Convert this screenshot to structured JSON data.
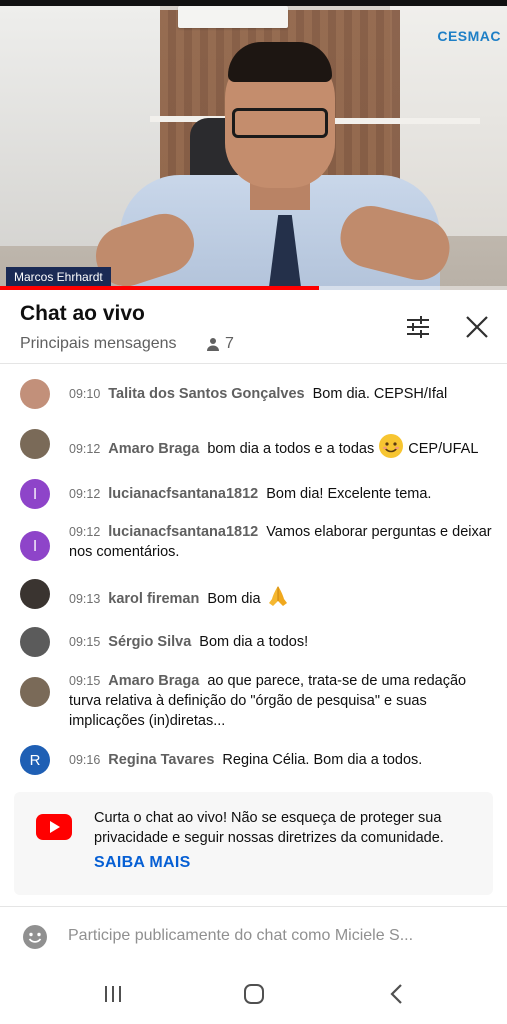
{
  "video": {
    "brand_text": "CESMAC",
    "presenter_name": "Marcos Ehrhardt",
    "progress_fraction": 0.63,
    "colors": {
      "progress": "#ff0000",
      "name_tag_bg": "#1a2a55",
      "brand": "#1e7fc6"
    }
  },
  "chat_header": {
    "title": "Chat ao vivo",
    "mode_label": "Principais mensagens",
    "viewer_count": "7",
    "icons": {
      "viewers": "person-icon",
      "filter": "sliders-icon",
      "close": "close-icon"
    }
  },
  "messages": [
    {
      "time": "09:10",
      "author": "Talita dos Santos Gonçalves",
      "text": "Bom dia. CEPSH/Ifal",
      "avatar_letter": "",
      "avatar_color": "#c2907a"
    },
    {
      "time": "09:12",
      "author": "Amaro Braga",
      "text": "bom dia a todos e a todas",
      "emoji": "😊",
      "text_after": "CEP/UFAL",
      "avatar_letter": "",
      "avatar_color": "#7a6a58"
    },
    {
      "time": "09:12",
      "author": "lucianacfsantana1812",
      "text": "Bom dia! Excelente tema.",
      "avatar_letter": "l",
      "avatar_color": "#8e44c9"
    },
    {
      "time": "09:12",
      "author": "lucianacfsantana1812",
      "text": "Vamos elaborar perguntas e deixar nos comentários.",
      "avatar_letter": "l",
      "avatar_color": "#8e44c9"
    },
    {
      "time": "09:13",
      "author": "karol fireman",
      "text": "Bom dia",
      "emoji": "🙏",
      "avatar_letter": "",
      "avatar_color": "#3a3430"
    },
    {
      "time": "09:15",
      "author": "Sérgio Silva",
      "text": "Bom dia a todos!",
      "avatar_letter": "",
      "avatar_color": "#5b5b5b"
    },
    {
      "time": "09:15",
      "author": "Amaro Braga",
      "text": "ao que parece, trata-se de uma redação turva relativa à definição do \"órgão de pesquisa\" e suas implicações (in)diretas...",
      "avatar_letter": "",
      "avatar_color": "#7a6a58"
    },
    {
      "time": "09:16",
      "author": "Regina Tavares",
      "text": "Regina Célia. Bom dia a todos.",
      "avatar_letter": "R",
      "avatar_color": "#1f5fb4"
    }
  ],
  "info_card": {
    "text": "Curta o chat ao vivo! Não se esqueça de proteger sua privacidade e seguir nossas diretrizes da comunidade.",
    "link_label": "SAIBA MAIS",
    "icon": "youtube-icon"
  },
  "input": {
    "placeholder": "Participe publicamente do chat como Miciele S...",
    "value": "",
    "icon": "smiley-icon"
  },
  "android_nav": {
    "icons": [
      "recents-icon",
      "home-icon",
      "back-icon"
    ]
  }
}
